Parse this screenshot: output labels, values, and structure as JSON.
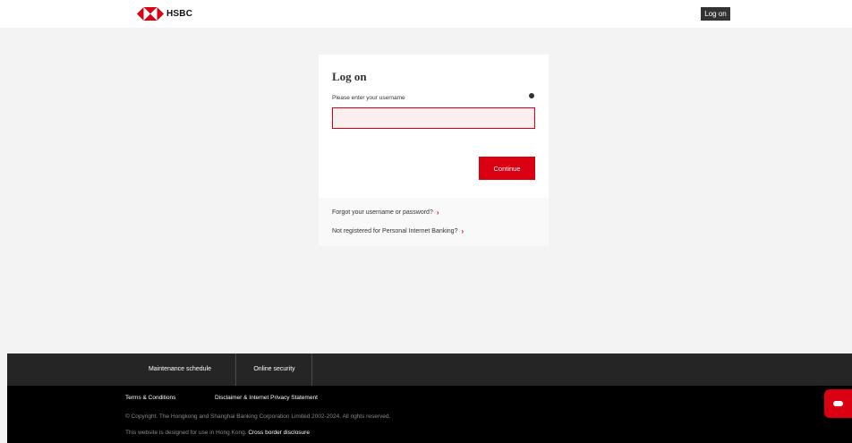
{
  "header": {
    "brand": "HSBC",
    "logon_button": "Log on",
    "brand_color": "#db0011"
  },
  "login_card": {
    "title": "Log on",
    "username_label": "Please enter your username",
    "username_value": "",
    "username_placeholder": "",
    "help_icon": "help-icon",
    "continue_label": "Continue",
    "forgot_link": "Forgot your username or password?",
    "register_link": "Not registered for Personal Internet Banking?"
  },
  "footer_nav": {
    "items": [
      {
        "label": "Maintenance schedule"
      },
      {
        "label": "Online security"
      }
    ]
  },
  "footer": {
    "terms": "Terms & Conditions",
    "disclaimer": "Disclaimer & Internet Privacy Statement",
    "copyright": "© Copyright. The Hongkong and Shanghai Banking Corporation Limited 2002-2024. All rights reserved.",
    "designed_for": "This website is designed for use in Hong Kong.",
    "cross_border": "Cross border disclosure"
  },
  "chat": {
    "icon": "chat-icon"
  }
}
